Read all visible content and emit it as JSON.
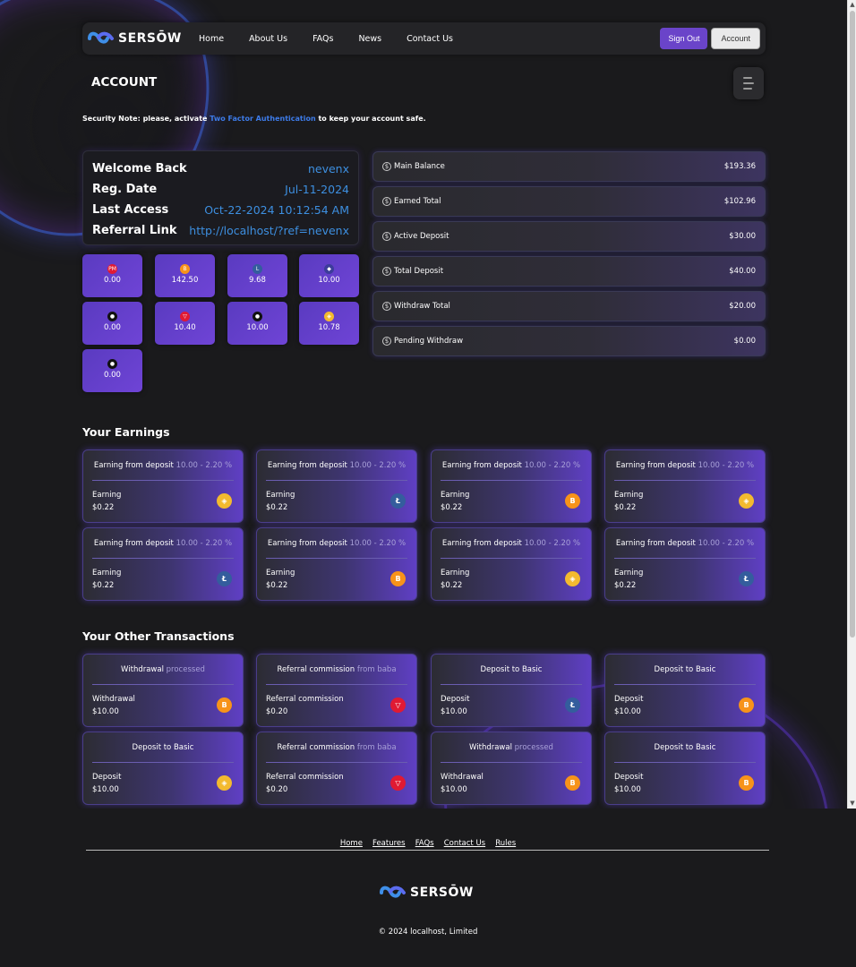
{
  "brand": {
    "name": "SERSŌW"
  },
  "nav": {
    "links": [
      "Home",
      "About Us",
      "FAQs",
      "News",
      "Contact Us"
    ],
    "signout": "Sign Out",
    "account": "Account"
  },
  "page": {
    "title": "ACCOUNT"
  },
  "security": {
    "prefix": "Security Note: please, activate",
    "link": "Two Factor Authentication",
    "suffix": "to keep your account safe."
  },
  "info": [
    {
      "label": "Welcome Back",
      "value": "nevenx"
    },
    {
      "label": "Reg. Date",
      "value": "Jul-11-2024"
    },
    {
      "label": "Last Access",
      "value": "Oct-22-2024 10:12:54 AM"
    },
    {
      "label": "Referral Link",
      "value": "http://localhost/?ref=nevenx"
    }
  ],
  "coins": [
    {
      "icon": "pm-icon",
      "glyph": "PM",
      "color": "#e01a33",
      "value": "0.00"
    },
    {
      "icon": "bitcoin-icon",
      "glyph": "B",
      "color": "#f7931a",
      "value": "142.50"
    },
    {
      "icon": "litecoin-icon",
      "glyph": "L",
      "color": "#345d9d",
      "value": "9.68"
    },
    {
      "icon": "ethereum-icon",
      "glyph": "◆",
      "color": "#3c3c9a",
      "value": "10.00"
    },
    {
      "icon": "coin-dark-icon",
      "glyph": "●",
      "color": "#111",
      "value": "0.00"
    },
    {
      "icon": "tron-icon",
      "glyph": "▽",
      "color": "#e01a33",
      "value": "10.40"
    },
    {
      "icon": "coin-black-icon",
      "glyph": "●",
      "color": "#111",
      "value": "10.00"
    },
    {
      "icon": "bnb-icon",
      "glyph": "◈",
      "color": "#f3ba2f",
      "value": "10.78"
    },
    {
      "icon": "coin-green-icon",
      "glyph": "●",
      "color": "#111",
      "value": "0.00"
    }
  ],
  "balances": [
    {
      "label": "Main Balance",
      "value": "$193.36"
    },
    {
      "label": "Earned Total",
      "value": "$102.96"
    },
    {
      "label": "Active Deposit",
      "value": "$30.00"
    },
    {
      "label": "Total Deposit",
      "value": "$40.00"
    },
    {
      "label": "Withdraw Total",
      "value": "$20.00"
    },
    {
      "label": "Pending Withdraw",
      "value": "$0.00"
    }
  ],
  "earnings": {
    "title": "Your Earnings",
    "items": [
      {
        "head": "Earning from deposit",
        "muted": "10.00 - 2.20 %",
        "label": "Earning",
        "amount": "$0.22",
        "coin": "bnb-icon",
        "glyph": "◈",
        "cls": "c-bnb"
      },
      {
        "head": "Earning from deposit",
        "muted": "10.00 - 2.20 %",
        "label": "Earning",
        "amount": "$0.22",
        "coin": "litecoin-icon",
        "glyph": "Ł",
        "cls": "c-ltc"
      },
      {
        "head": "Earning from deposit",
        "muted": "10.00 - 2.20 %",
        "label": "Earning",
        "amount": "$0.22",
        "coin": "bitcoin-icon",
        "glyph": "B",
        "cls": "c-btc"
      },
      {
        "head": "Earning from deposit",
        "muted": "10.00 - 2.20 %",
        "label": "Earning",
        "amount": "$0.22",
        "coin": "bnb-icon",
        "glyph": "◈",
        "cls": "c-bnb"
      },
      {
        "head": "Earning from deposit",
        "muted": "10.00 - 2.20 %",
        "label": "Earning",
        "amount": "$0.22",
        "coin": "litecoin-icon",
        "glyph": "Ł",
        "cls": "c-ltc"
      },
      {
        "head": "Earning from deposit",
        "muted": "10.00 - 2.20 %",
        "label": "Earning",
        "amount": "$0.22",
        "coin": "bitcoin-icon",
        "glyph": "B",
        "cls": "c-btc"
      },
      {
        "head": "Earning from deposit",
        "muted": "10.00 - 2.20 %",
        "label": "Earning",
        "amount": "$0.22",
        "coin": "bnb-icon",
        "glyph": "◈",
        "cls": "c-bnb"
      },
      {
        "head": "Earning from deposit",
        "muted": "10.00 - 2.20 %",
        "label": "Earning",
        "amount": "$0.22",
        "coin": "litecoin-icon",
        "glyph": "Ł",
        "cls": "c-ltc"
      }
    ]
  },
  "transactions": {
    "title": "Your Other Transactions",
    "items": [
      {
        "head": "Withdrawal",
        "muted": "processed",
        "label": "Withdrawal",
        "amount": "$10.00",
        "coin": "bitcoin-icon",
        "glyph": "B",
        "cls": "c-btc"
      },
      {
        "head": "Referral commission",
        "muted": "from baba",
        "label": "Referral commission",
        "amount": "$0.20",
        "coin": "tron-icon",
        "glyph": "▽",
        "cls": "c-trx"
      },
      {
        "head": "Deposit to Basic",
        "muted": "",
        "label": "Deposit",
        "amount": "$10.00",
        "coin": "litecoin-icon",
        "glyph": "Ł",
        "cls": "c-ltc"
      },
      {
        "head": "Deposit to Basic",
        "muted": "",
        "label": "Deposit",
        "amount": "$10.00",
        "coin": "bitcoin-icon",
        "glyph": "B",
        "cls": "c-btc"
      },
      {
        "head": "Deposit to Basic",
        "muted": "",
        "label": "Deposit",
        "amount": "$10.00",
        "coin": "bnb-icon",
        "glyph": "◈",
        "cls": "c-bnb"
      },
      {
        "head": "Referral commission",
        "muted": "from baba",
        "label": "Referral commission",
        "amount": "$0.20",
        "coin": "tron-icon",
        "glyph": "▽",
        "cls": "c-trx"
      },
      {
        "head": "Withdrawal",
        "muted": "processed",
        "label": "Withdrawal",
        "amount": "$10.00",
        "coin": "bitcoin-icon",
        "glyph": "B",
        "cls": "c-btc"
      },
      {
        "head": "Deposit to Basic",
        "muted": "",
        "label": "Deposit",
        "amount": "$10.00",
        "coin": "bitcoin-icon",
        "glyph": "B",
        "cls": "c-btc"
      }
    ]
  },
  "footer": {
    "links": [
      "Home",
      "Features",
      "FAQs",
      "Contact Us",
      "Rules"
    ],
    "copyright": "© 2024 localhost, Limited"
  }
}
